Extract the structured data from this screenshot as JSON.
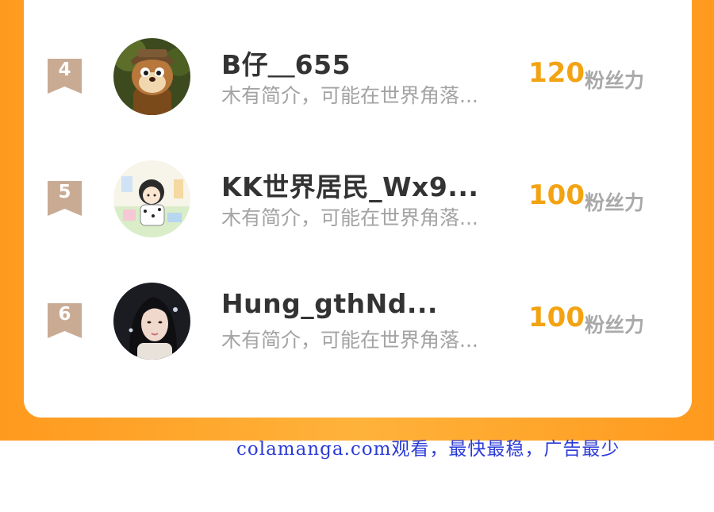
{
  "leaderboard": {
    "score_label": "粉丝力",
    "rows": [
      {
        "rank": "4",
        "name": "B仔＿655",
        "bio": "木有简介，可能在世界角落...",
        "score": "120",
        "avatar_icon": "chipmunk-avatar-icon"
      },
      {
        "rank": "5",
        "name": "KK世界居民_Wx9...",
        "bio": "木有简介，可能在世界角落...",
        "score": "100",
        "avatar_icon": "cartoon-girl-avatar-icon"
      },
      {
        "rank": "6",
        "name": "Hung_gthNd...",
        "bio": "木有简介，可能在世界角落...",
        "score": "100",
        "avatar_icon": "woman-portrait-avatar-icon"
      }
    ]
  },
  "watermark": "colamanga.com观看，最快最稳，广告最少",
  "colors": {
    "accent_orange": "#ff9a1e",
    "score_color": "#f3a312",
    "rank_badge": "#c9ab94",
    "watermark_blue": "#2b3bd8"
  }
}
